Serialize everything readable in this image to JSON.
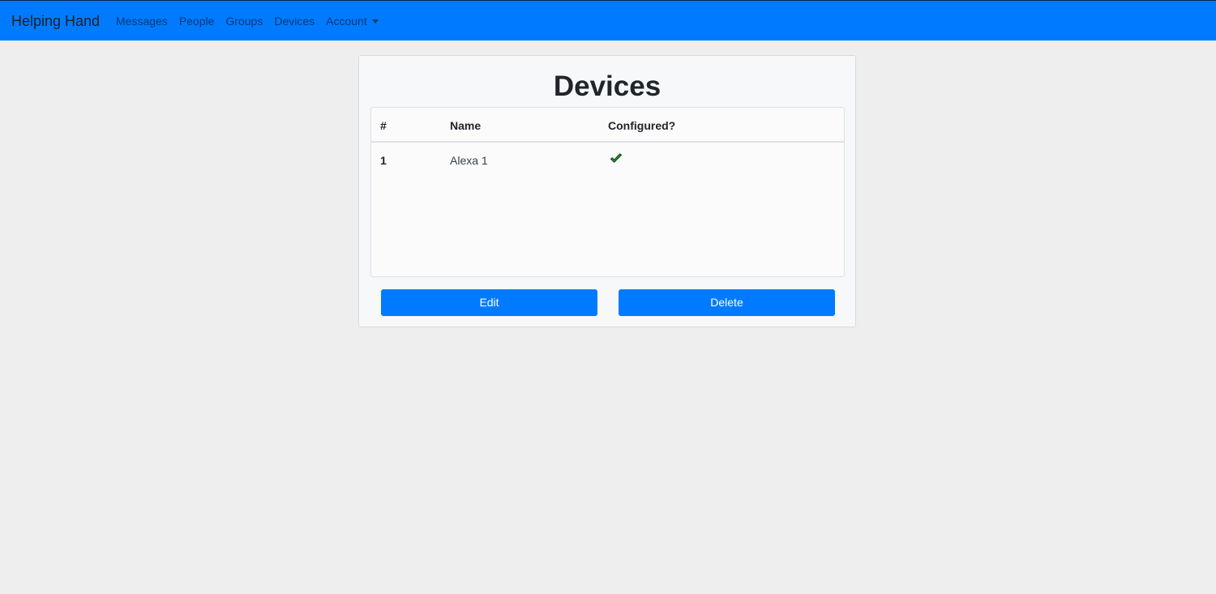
{
  "navbar": {
    "brand": "Helping Hand",
    "links": [
      "Messages",
      "People",
      "Groups",
      "Devices"
    ],
    "account": "Account"
  },
  "page": {
    "title": "Devices"
  },
  "table": {
    "headers": [
      "#",
      "Name",
      "Configured?"
    ],
    "rows": [
      {
        "num": "1",
        "name": "Alexa 1",
        "configured": true
      }
    ]
  },
  "actions": {
    "edit": "Edit",
    "delete": "Delete"
  },
  "colors": {
    "primary": "#007bff",
    "check": "#1e9e2e"
  },
  "icons": {
    "configured": "checkmark-icon",
    "account_dropdown": "caret-down-icon"
  }
}
